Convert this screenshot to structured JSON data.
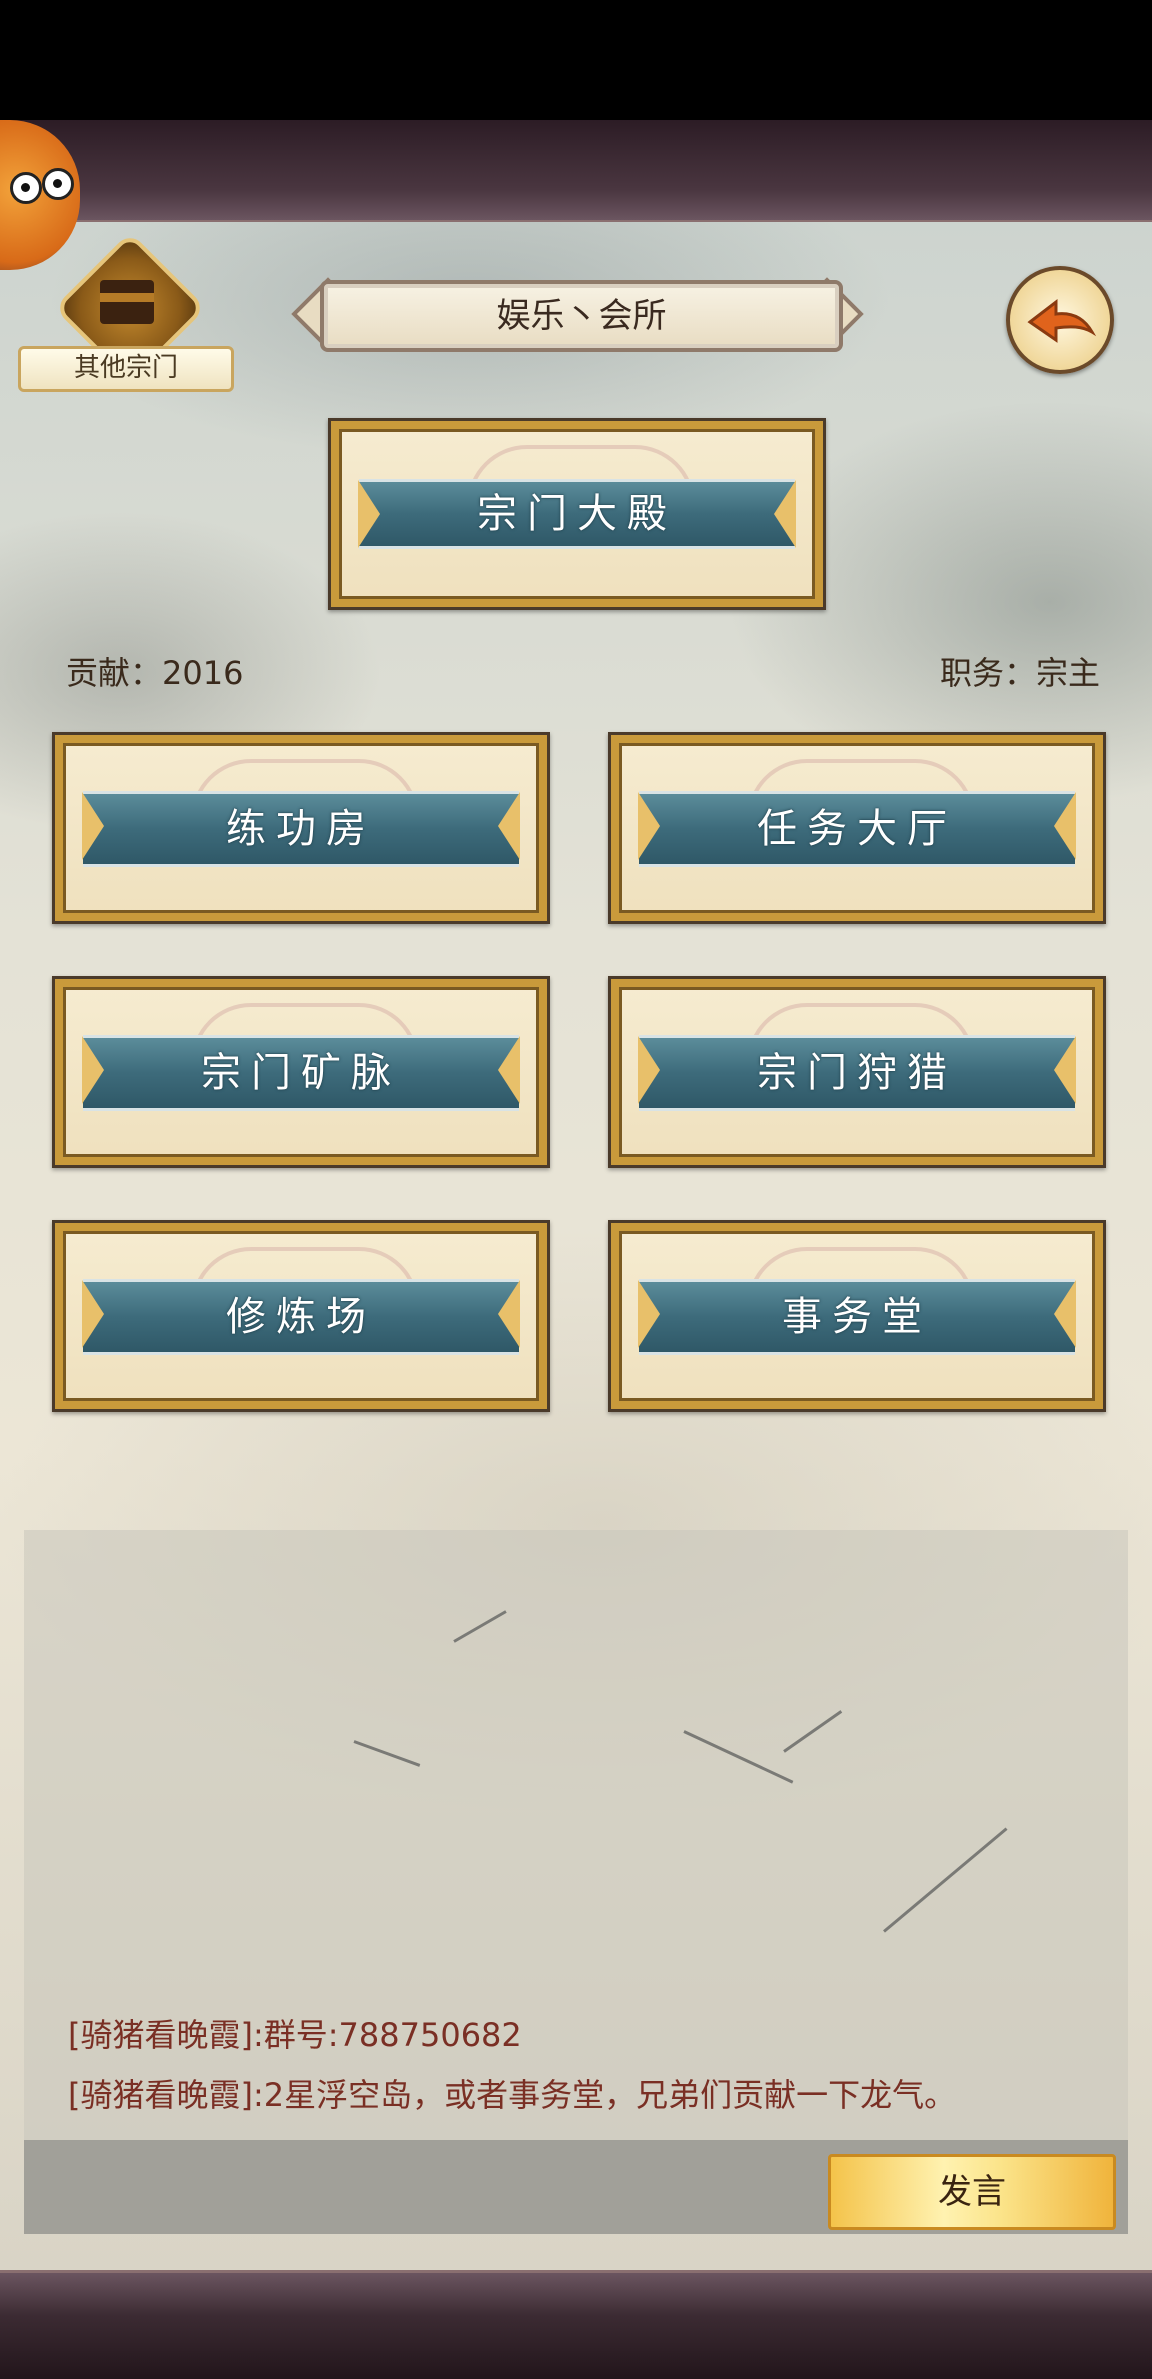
{
  "header": {
    "title": "娱乐丶会所",
    "other_sects_label": "其他宗门"
  },
  "main_hall": {
    "label": "宗门大殿"
  },
  "stats": {
    "contribution": "贡献：2016",
    "position": "职务：宗主"
  },
  "buttons": [
    {
      "label": "练功房"
    },
    {
      "label": "任务大厅"
    },
    {
      "label": "宗门矿脉"
    },
    {
      "label": "宗门狩猎"
    },
    {
      "label": "修炼场"
    },
    {
      "label": "事务堂"
    }
  ],
  "chat": {
    "messages": [
      "[骑猪看晚霞]:群号:788750682",
      "[骑猪看晚霞]:2星浮空岛，或者事务堂，兄弟们贡献一下龙气。"
    ],
    "send_label": "发言"
  },
  "colors": {
    "banner_band": "#3d6b7b",
    "gold_trim": "#c99a3b",
    "chat_text": "#7a2f24",
    "send_button": "#f4c34a"
  },
  "icons": {
    "back": "back-arrow-icon",
    "sect": "sect-building-icon",
    "fan": "fan-icon"
  }
}
